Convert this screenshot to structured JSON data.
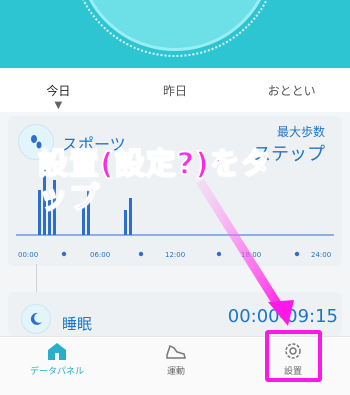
{
  "tabs": {
    "today": "今日",
    "yesterday": "昨日",
    "day_before": "おととい"
  },
  "sports_card": {
    "title": "スポーツ",
    "right_line1": "最大歩数",
    "right_line2": "ステップ"
  },
  "chart_axis": [
    "00:00",
    "06:00",
    "12:00",
    "18:00",
    "24:00"
  ],
  "sleep_card": {
    "title": "睡眠",
    "time_range": "00:00-09:15"
  },
  "nav": {
    "data_panel": "データパネル",
    "exercise": "運動",
    "settings": "設置"
  },
  "annotation": {
    "text": "設置(設定?)をタップ"
  },
  "colors": {
    "accent": "#2ec5d3",
    "annotation": "#ff19e6",
    "text_blue": "#1f75c9"
  }
}
